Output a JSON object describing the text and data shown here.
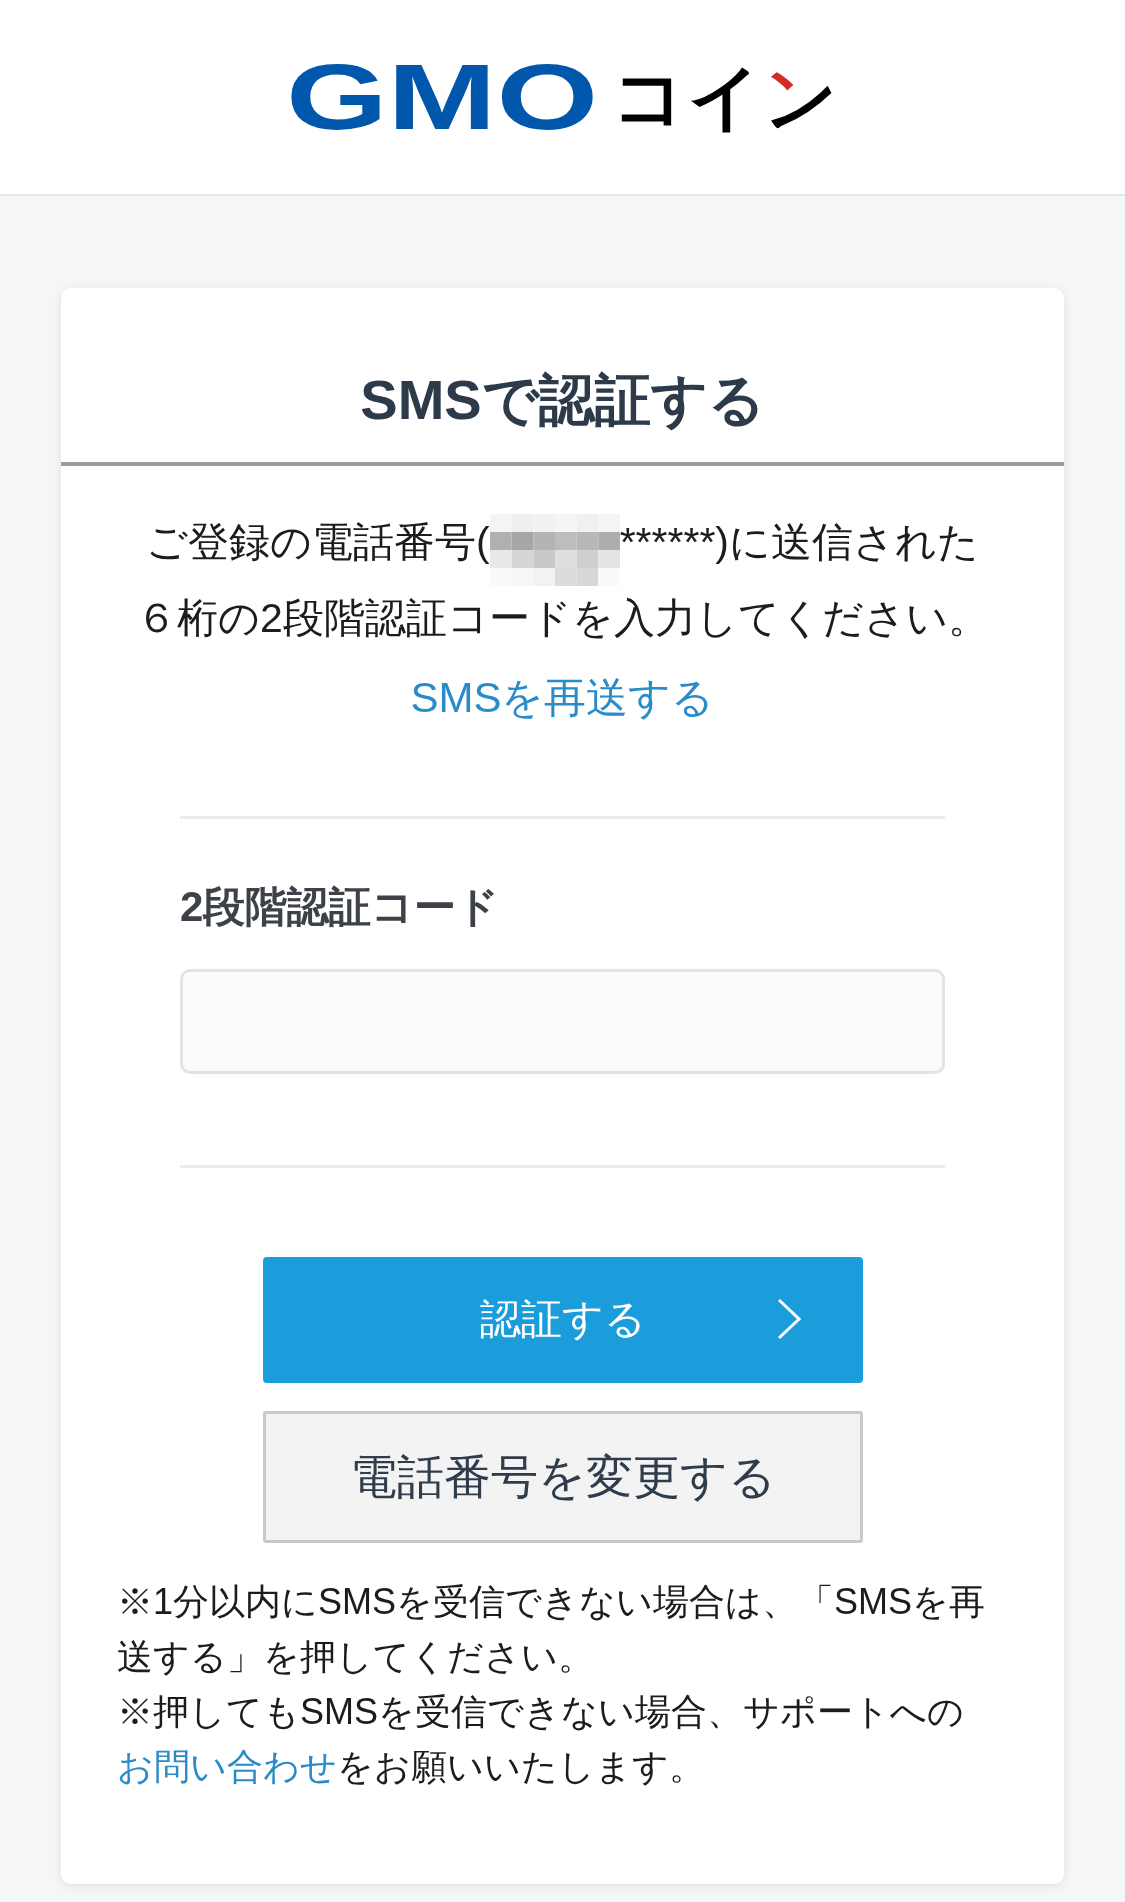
{
  "header": {
    "logo": {
      "latin": "GMO",
      "katakana": "コイン"
    }
  },
  "card": {
    "title": "SMSで認証する",
    "message": {
      "prefix": "ご登録の電話番号(",
      "suffix": "******)に送信された",
      "second_line": "６桁の2段階認証コードを入力してください。"
    },
    "resend_link": "SMSを再送する",
    "code_field": {
      "label": "2段階認証コード"
    },
    "buttons": [
      {
        "kind": "primary",
        "label": "認証する"
      },
      {
        "kind": "secondary",
        "label": "電話番号を変更する"
      }
    ],
    "notes": [
      {
        "text": "※1分以内にSMSを受信できない場合は、「SMSを再送する」を押してください。"
      },
      {
        "text": "※押してもSMSを受信できない場合、サポートへの",
        "link": "お問い合わせ",
        "after_link": "をお願いいたします。"
      }
    ]
  }
}
